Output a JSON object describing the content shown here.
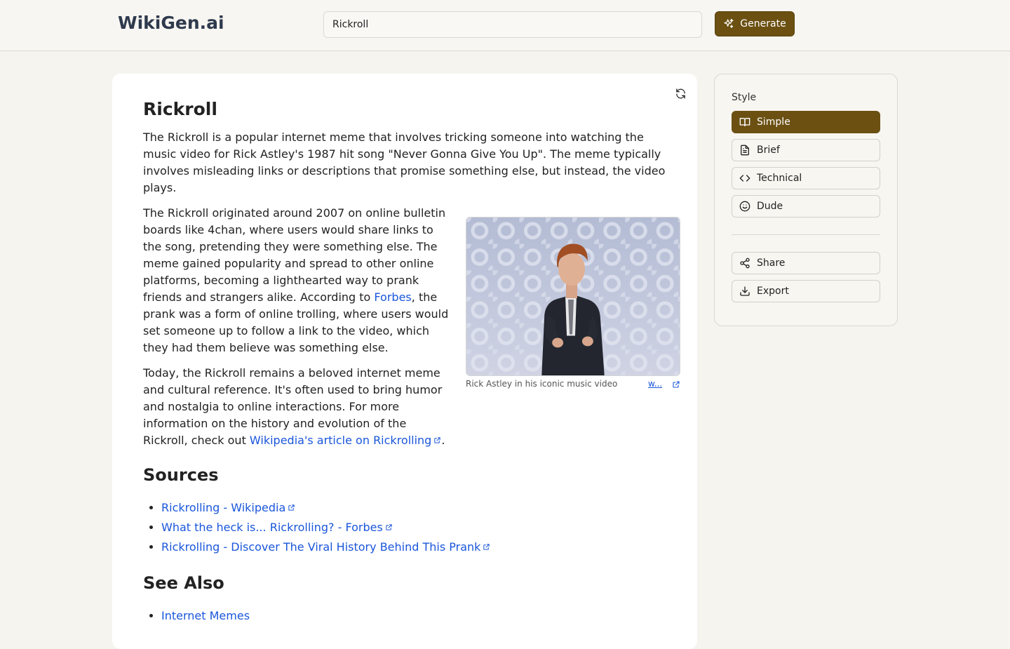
{
  "header": {
    "logo": "WikiGen.ai",
    "search_value": "Rickroll",
    "generate_label": "Generate"
  },
  "article": {
    "title": "Rickroll",
    "p1": "The Rickroll is a popular internet meme that involves tricking someone into watching the music video for Rick Astley's 1987 hit song \"Never Gonna Give You Up\". The meme typically involves misleading links or descriptions that promise something else, but instead, the video plays.",
    "p2_before": "The Rickroll originated around 2007 on online bulletin boards like 4chan, where users would share links to the song, pretending they were something else. The meme gained popularity and spread to other online platforms, becoming a lighthearted way to prank friends and strangers alike. According to ",
    "p2_link": "Forbes",
    "p2_after": ", the prank was a form of online trolling, where users would set someone up to follow a link to the video, which they had them believe was something else.",
    "p3_before": "Today, the Rickroll remains a beloved internet meme and cultural reference. It's often used to bring humor and nostalgia to online interactions. For more information on the history and evolution of the Rickroll, check out ",
    "p3_link": "Wikipedia's article on Rickrolling",
    "p3_after": ".",
    "figure": {
      "caption": "Rick Astley in his iconic music video",
      "source_link": "w..."
    },
    "sources_heading": "Sources",
    "sources": [
      "Rickrolling - Wikipedia",
      "What the heck is... Rickrolling? - Forbes",
      "Rickrolling - Discover The Viral History Behind This Prank"
    ],
    "see_also_heading": "See Also",
    "see_also": [
      "Internet Memes"
    ]
  },
  "sidebar": {
    "style_label": "Style",
    "styles": [
      {
        "label": "Simple",
        "icon": "book-open-icon",
        "active": true
      },
      {
        "label": "Brief",
        "icon": "document-icon",
        "active": false
      },
      {
        "label": "Technical",
        "icon": "code-icon",
        "active": false
      },
      {
        "label": "Dude",
        "icon": "smiley-icon",
        "active": false
      }
    ],
    "share_label": "Share",
    "export_label": "Export"
  },
  "colors": {
    "accent": "#6b5012",
    "link": "#1a56db",
    "background": "#f6f4ef"
  }
}
